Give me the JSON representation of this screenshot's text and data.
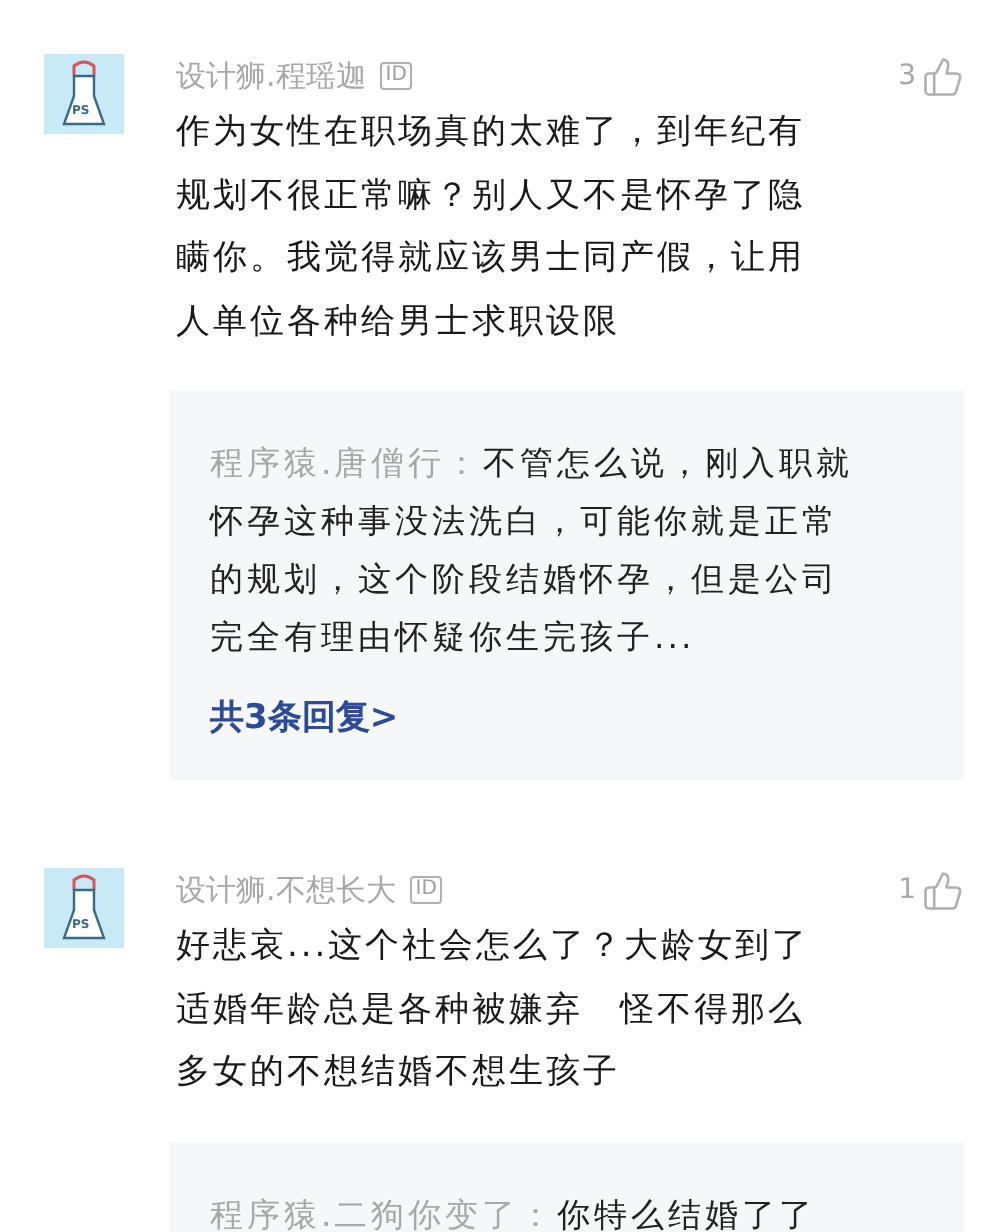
{
  "comments": [
    {
      "avatar_label": "PS",
      "author": "设计狮.程瑶迦",
      "badge": "ID",
      "likes": "3",
      "lines": [
        "作为女性在职场真的太难了，到年纪有",
        "规划不很正常嘛？别人又不是怀孕了隐",
        "瞒你。我觉得就应该男士同产假，让用",
        "人单位各种给男士求职设限"
      ],
      "reply": {
        "author": "程序猿.唐僧行：",
        "lines": [
          "不管怎么说，刚入职就",
          "怀孕这种事没法洗白，可能你就是正常",
          "的规划，这个阶段结婚怀孕，但是公司",
          "完全有理由怀疑你生完孩子..."
        ],
        "more": "共3条回复>"
      }
    },
    {
      "avatar_label": "PS",
      "author": "设计狮.不想长大",
      "badge": "ID",
      "likes": "1",
      "lines": [
        "好悲哀...这个社会怎么了？大龄女到了",
        "适婚年龄总是各种被嫌弃　怪不得那么",
        "多女的不想结婚不想生孩子"
      ],
      "reply": {
        "author": "程序猿.二狗你变了：",
        "lines": [
          "你特么结婚了了"
        ]
      }
    }
  ]
}
